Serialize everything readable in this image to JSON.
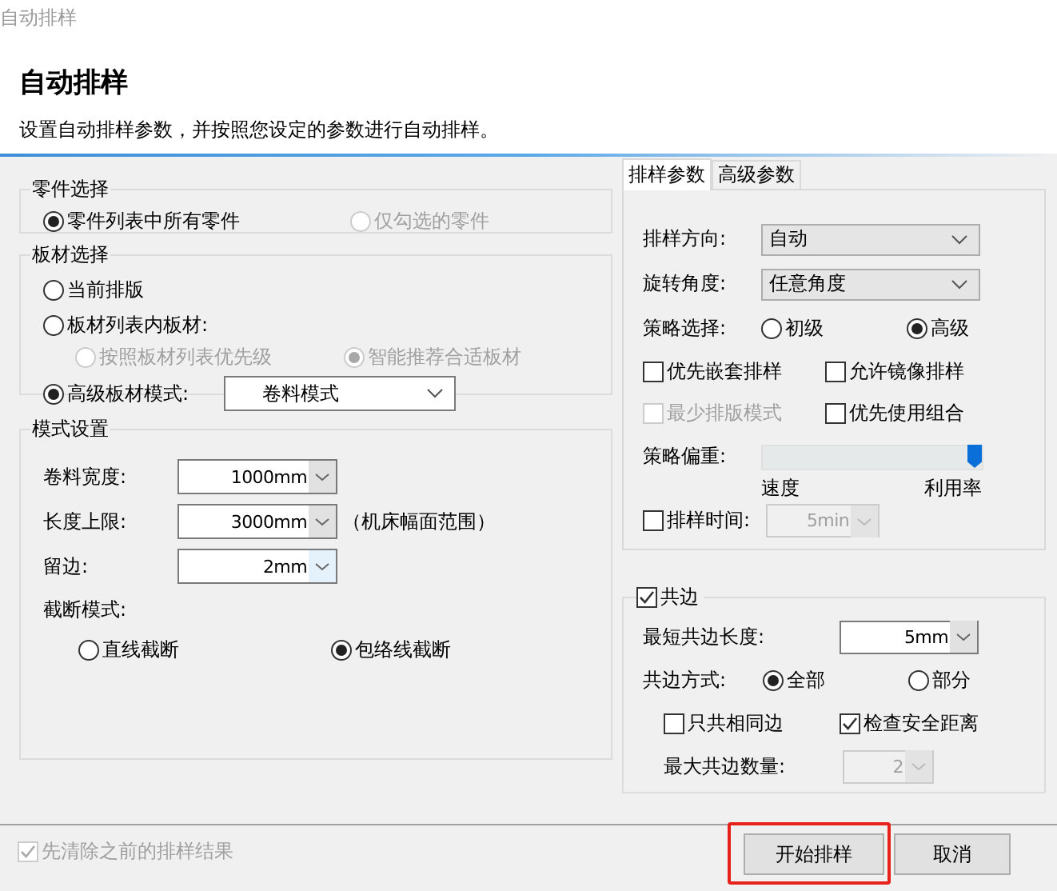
{
  "window": {
    "title": "自动排样"
  },
  "header": {
    "title": "自动排样",
    "description": "设置自动排样参数，并按照您设定的参数进行自动排样。"
  },
  "part_selection": {
    "title": "零件选择",
    "options": [
      {
        "label": "零件列表中所有零件",
        "selected": true,
        "disabled": false
      },
      {
        "label": "仅勾选的零件",
        "selected": false,
        "disabled": true
      }
    ]
  },
  "sheet_selection": {
    "title": "板材选择",
    "options": [
      {
        "label": "当前排版",
        "selected": false,
        "disabled": false
      },
      {
        "label": "板材列表内板材:",
        "selected": false,
        "disabled": false
      },
      {
        "label": "高级板材模式:",
        "selected": true,
        "disabled": false
      }
    ],
    "sub_options": [
      {
        "label": "按照板材列表优先级",
        "selected": false,
        "disabled": true
      },
      {
        "label": "智能推荐合适板材",
        "selected": true,
        "disabled": true
      }
    ],
    "mode_dropdown": "卷料模式"
  },
  "mode_settings": {
    "title": "模式设置",
    "fields": [
      {
        "label": "卷料宽度:",
        "value": "1000mm",
        "focused": false
      },
      {
        "label": "长度上限:",
        "value": "3000mm",
        "note": "（机床幅面范围）",
        "focused": false
      },
      {
        "label": "留边:",
        "value": "2mm",
        "focused": true
      }
    ],
    "cut_mode": {
      "label": "截断模式:",
      "options": [
        {
          "label": "直线截断",
          "selected": false
        },
        {
          "label": "包络线截断",
          "selected": true
        }
      ]
    }
  },
  "tabs": [
    {
      "label": "排样参数",
      "selected": true
    },
    {
      "label": "高级参数",
      "selected": false
    }
  ],
  "nesting": {
    "direction": {
      "label": "排样方向:",
      "value": "自动"
    },
    "rotation": {
      "label": "旋转角度:",
      "value": "任意角度"
    },
    "strategy": {
      "label": "策略选择:",
      "options": [
        {
          "label": "初级",
          "selected": false
        },
        {
          "label": "高级",
          "selected": true
        }
      ]
    },
    "checkboxes": [
      {
        "label": "优先嵌套排样",
        "checked": false,
        "disabled": false
      },
      {
        "label": "允许镜像排样",
        "checked": false,
        "disabled": false
      },
      {
        "label": "最少排版模式",
        "checked": false,
        "disabled": true
      },
      {
        "label": "优先使用组合",
        "checked": false,
        "disabled": false
      }
    ],
    "bias": {
      "label": "策略偏重:",
      "level": 1,
      "min_label": "速度",
      "max_label": "利用率"
    },
    "time": {
      "label": "排样时间:",
      "checked": false,
      "value": "5min",
      "disabled": true
    }
  },
  "common_edge": {
    "label": "共边",
    "checked": true,
    "min_length": {
      "label": "最短共边长度:",
      "value": "5mm"
    },
    "mode": {
      "label": "共边方式:",
      "options": [
        {
          "label": "全部",
          "selected": true
        },
        {
          "label": "部分",
          "selected": false
        }
      ]
    },
    "checkboxes": [
      {
        "label": "只共相同边",
        "checked": false
      },
      {
        "label": "检查安全距离",
        "checked": true
      }
    ],
    "max_count": {
      "label": "最大共边数量:",
      "value": "2",
      "disabled": true
    }
  },
  "footer": {
    "clear": {
      "label": "先清除之前的排样结果",
      "checked": true,
      "disabled": true
    },
    "buttons": [
      {
        "label": "开始排样",
        "highlighted": true
      },
      {
        "label": "取消",
        "highlighted": false
      }
    ]
  }
}
